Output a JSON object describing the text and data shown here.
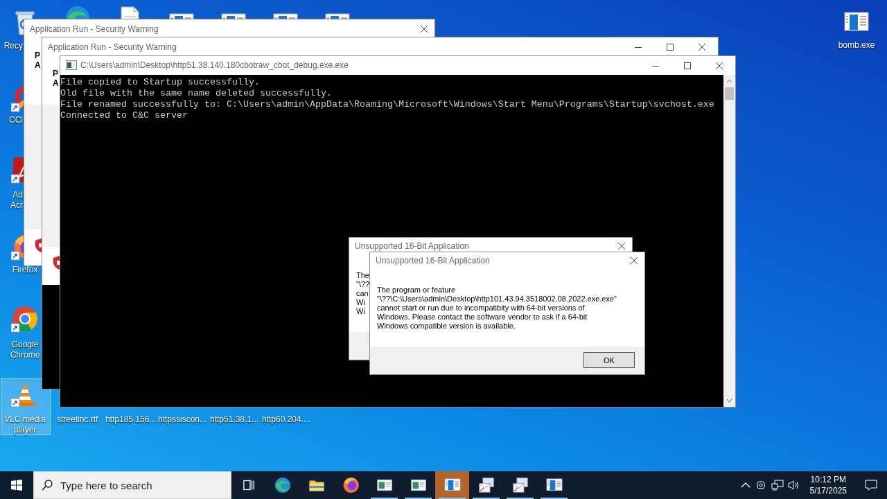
{
  "desktop_icons": [
    {
      "kind": "recycle_bin",
      "label": "Recy",
      "selected": false
    },
    {
      "kind": "cleaner",
      "label": "CCl",
      "selected": false
    },
    {
      "kind": "pdf_reader",
      "label": "Ad\nAcr",
      "selected": false
    },
    {
      "kind": "firefox",
      "label": "Firefox",
      "selected": false
    },
    {
      "kind": "chrome",
      "label": "Google Chrome",
      "selected": false
    },
    {
      "kind": "vlc",
      "label": "VLC media player",
      "selected": true
    },
    {
      "kind": "edge",
      "selected": false
    },
    {
      "kind": "document",
      "selected": false
    },
    {
      "kind": "program",
      "selected": false
    },
    {
      "kind": "program",
      "selected": false
    },
    {
      "kind": "program",
      "selected": false
    },
    {
      "kind": "program",
      "selected": false
    },
    {
      "kind": "program",
      "label": "bomb.exe",
      "selected": false
    }
  ],
  "file_labels": [
    "streetinc.rtf",
    "http185.156...",
    "httpssiscon...",
    "http51.38.1...",
    "http60.204...."
  ],
  "windows": [
    {
      "kind": "security_warning",
      "title": "Application Run - Security Warning",
      "minmax": false,
      "fragments": [
        "P",
        "A"
      ]
    },
    {
      "kind": "security_warning",
      "title": "Application Run - Security Warning",
      "minmax": true,
      "fragments": [
        "P",
        "A"
      ]
    },
    {
      "kind": "console",
      "title": "C:\\Users\\admin\\Desktop\\http51.38.140.180cbotraw_cbot_debug.exe.exe",
      "minmax": true,
      "lines": [
        "File copied to Startup successfully.",
        "Old file with the same name deleted successfully.",
        "File renamed successfully to: C:\\Users\\admin\\AppData\\Roaming\\Microsoft\\Windows\\Start Menu\\Programs\\Startup\\svchost.exe",
        "Connected to C&C server"
      ]
    },
    {
      "kind": "message_box",
      "title": "Unsupported 16-Bit Application",
      "minmax": false,
      "fragments": [
        "The",
        "\"\\??",
        "can",
        "Wi",
        "Wi"
      ]
    },
    {
      "kind": "message_box",
      "title": "Unsupported 16-Bit Application",
      "minmax": false,
      "message": "The program or feature\n\"\\??\\C:\\Users\\admin\\Desktop\\http101.43.94.3518002.08.2022.exe.exe\"\ncannot start or run due to incompatibity with 64-bit versions of\nWindows. Please contact the software vendor to ask if a 64-bit\nWindows compatible version is available.",
      "button": "OK"
    }
  ],
  "taskbar": {
    "search": {
      "placeholder": "Type here to search"
    },
    "apps": [
      {
        "kind": "task_view",
        "running": false,
        "selected": false
      },
      {
        "kind": "edge",
        "running": false,
        "selected": false
      },
      {
        "kind": "explorer",
        "running": false,
        "selected": false
      },
      {
        "kind": "firefox",
        "running": false,
        "selected": false
      },
      {
        "kind": "app_window",
        "running": true,
        "selected": false
      },
      {
        "kind": "app_window",
        "running": true,
        "selected": false
      },
      {
        "kind": "program",
        "running": true,
        "selected": true
      },
      {
        "kind": "mail",
        "running": true,
        "selected": false
      },
      {
        "kind": "mail",
        "running": true,
        "selected": false
      },
      {
        "kind": "program",
        "running": true,
        "selected": false
      }
    ],
    "clock": {
      "time": "10:12 PM",
      "date": "5/17/2025"
    }
  }
}
